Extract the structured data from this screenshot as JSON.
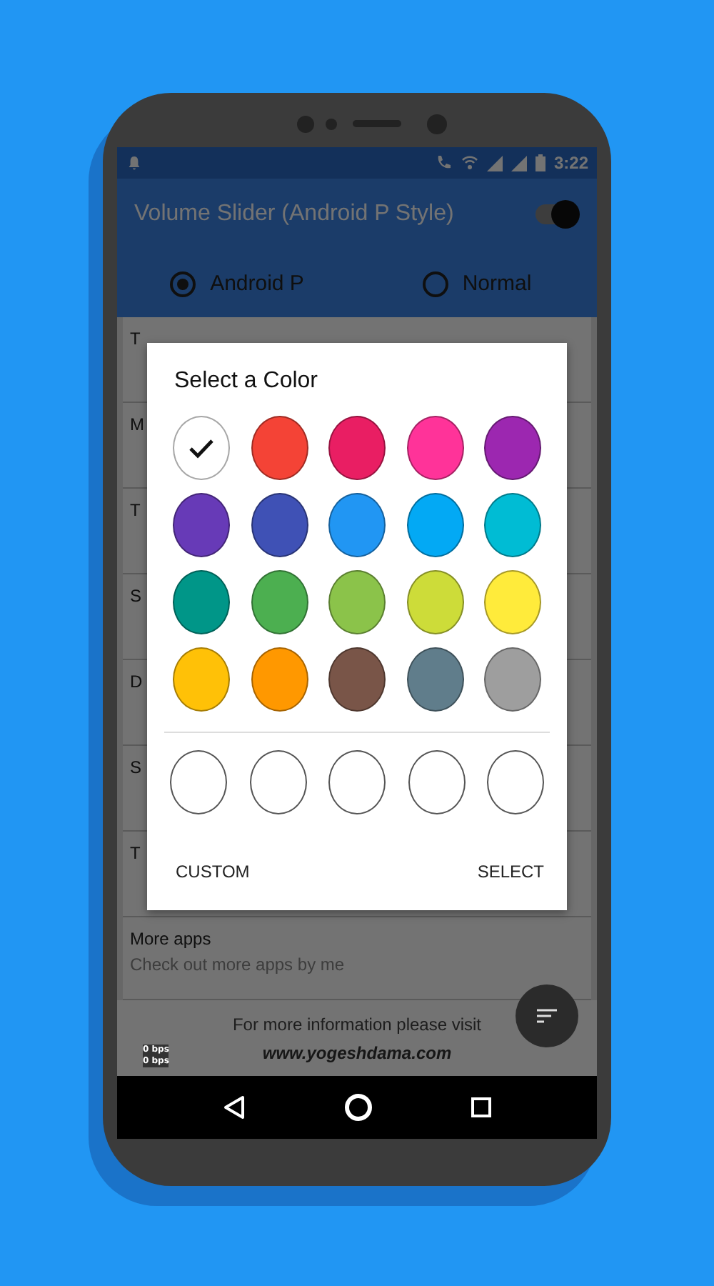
{
  "status_bar": {
    "time": "3:22"
  },
  "app_bar": {
    "title": "Volume Slider (Android P Style)",
    "on": true
  },
  "style_options": [
    {
      "label": "Android P",
      "selected": true
    },
    {
      "label": "Normal",
      "selected": false
    }
  ],
  "settings": [
    {
      "title": "T"
    },
    {
      "title": "M"
    },
    {
      "title": "T"
    },
    {
      "title": "S"
    },
    {
      "title": "D"
    },
    {
      "title": "S"
    },
    {
      "title": "T"
    },
    {
      "title": "More apps",
      "subtitle": "Check out more apps by me"
    }
  ],
  "footer": {
    "text": "For more information please visit",
    "link": "www.yogeshdama.com"
  },
  "net_speed": [
    "0 bps",
    "0 bps"
  ],
  "dialog": {
    "title": "Select a Color",
    "colors": [
      {
        "color": "#ffffff",
        "selected": true
      },
      {
        "color": "#f44336",
        "selected": false
      },
      {
        "color": "#e91e63",
        "selected": false
      },
      {
        "color": "#ff3399",
        "selected": false
      },
      {
        "color": "#9c27b0",
        "selected": false
      },
      {
        "color": "#673ab7",
        "selected": false
      },
      {
        "color": "#3f51b5",
        "selected": false
      },
      {
        "color": "#2196f3",
        "selected": false
      },
      {
        "color": "#03a9f4",
        "selected": false
      },
      {
        "color": "#00bcd4",
        "selected": false
      },
      {
        "color": "#009688",
        "selected": false
      },
      {
        "color": "#4caf50",
        "selected": false
      },
      {
        "color": "#8bc34a",
        "selected": false
      },
      {
        "color": "#cddc39",
        "selected": false
      },
      {
        "color": "#ffeb3b",
        "selected": false
      },
      {
        "color": "#ffc107",
        "selected": false
      },
      {
        "color": "#ff9800",
        "selected": false
      },
      {
        "color": "#795548",
        "selected": false
      },
      {
        "color": "#607d8b",
        "selected": false
      },
      {
        "color": "#9e9e9e",
        "selected": false
      }
    ],
    "recent": [
      {
        "kind": "empty"
      },
      {
        "kind": "empty"
      },
      {
        "kind": "empty"
      },
      {
        "kind": "empty"
      },
      {
        "kind": "empty"
      }
    ],
    "buttons": [
      "CUSTOM",
      "SELECT"
    ]
  }
}
